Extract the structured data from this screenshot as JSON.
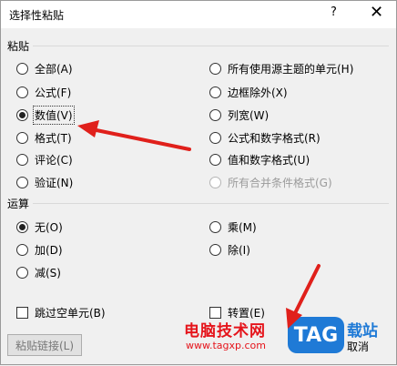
{
  "window": {
    "title": "选择性粘贴",
    "help": "?",
    "close": "✕"
  },
  "paste": {
    "label": "粘贴",
    "left": [
      {
        "label": "全部(A)",
        "checked": false
      },
      {
        "label": "公式(F)",
        "checked": false
      },
      {
        "label": "数值(V)",
        "checked": true
      },
      {
        "label": "格式(T)",
        "checked": false
      },
      {
        "label": "评论(C)",
        "checked": false
      },
      {
        "label": "验证(N)",
        "checked": false
      }
    ],
    "right": [
      {
        "label": "所有使用源主题的单元(H)",
        "checked": false
      },
      {
        "label": "边框除外(X)",
        "checked": false
      },
      {
        "label": "列宽(W)",
        "checked": false
      },
      {
        "label": "公式和数字格式(R)",
        "checked": false
      },
      {
        "label": "值和数字格式(U)",
        "checked": false
      },
      {
        "label": "所有合并条件格式(G)",
        "checked": false,
        "disabled": true
      }
    ]
  },
  "operation": {
    "label": "运算",
    "left": [
      {
        "label": "无(O)",
        "checked": true
      },
      {
        "label": "加(D)",
        "checked": false
      },
      {
        "label": "减(S)",
        "checked": false
      }
    ],
    "right": [
      {
        "label": "乘(M)",
        "checked": false
      },
      {
        "label": "除(I)",
        "checked": false
      }
    ]
  },
  "skip_blanks": {
    "label": "跳过空单元(B)",
    "checked": false
  },
  "transpose": {
    "label": "转置(E)",
    "checked": false
  },
  "paste_link_button": "粘贴链接(L)",
  "cancel_button": "取消",
  "watermark": {
    "site": "电脑技术网",
    "url": "www.tagxp.com",
    "tag": "TAG",
    "suffix": "载站"
  },
  "colors": {
    "arrow": "#e0201b",
    "watermark_red": "#e5141b",
    "watermark_blue": "#1f7ad6"
  }
}
